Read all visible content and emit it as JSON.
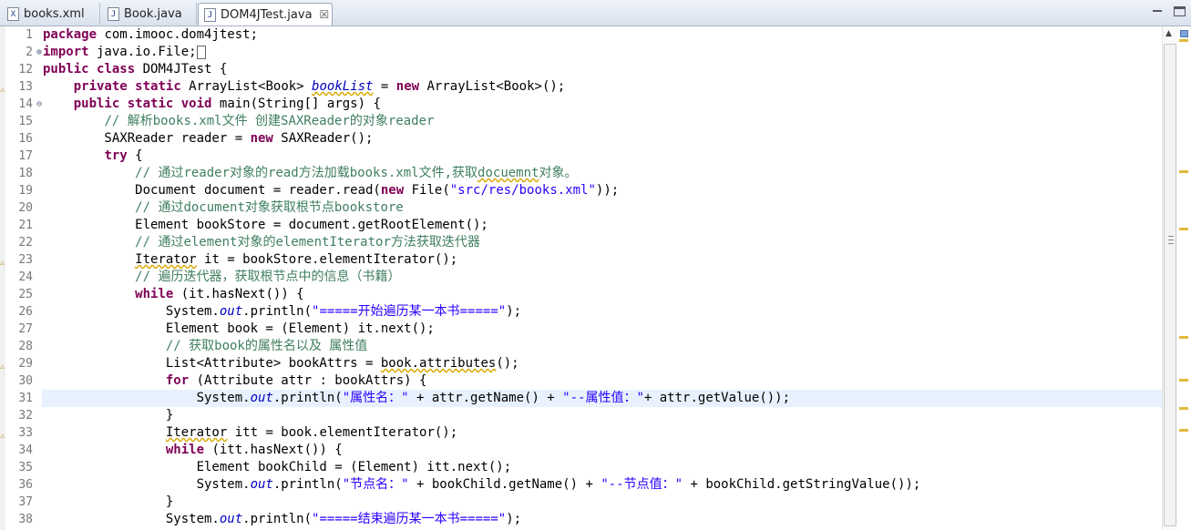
{
  "tabs": [
    {
      "label": "books.xml",
      "icon": "xml-file-icon",
      "glyph": "X",
      "active": false
    },
    {
      "label": "Book.java",
      "icon": "java-file-icon",
      "glyph": "J",
      "active": false
    },
    {
      "label": "DOM4JTest.java",
      "icon": "java-file-icon",
      "glyph": "J",
      "active": true,
      "close": "☒"
    }
  ],
  "editor": {
    "current_line": 31,
    "lines": [
      {
        "no": "1",
        "html": "<span class=\"kw\">package</span> com.imooc.dom4jtest;"
      },
      {
        "no": "2",
        "fold": "⊕",
        "html": "<span class=\"kw\">import</span> java.io.File;<span style=\"display:inline-block;width:8px;height:13px;border:1px solid #666;vertical-align:middle;\"></span>"
      },
      {
        "no": "12",
        "html": "<span class=\"kw\">public</span> <span class=\"kw\">class</span> DOM4JTest {"
      },
      {
        "no": "13",
        "marker": true,
        "html": "    <span class=\"kw\">private</span> <span class=\"kw\">static</span> ArrayList&lt;Book&gt; <span class=\"fld warn\">bookList</span> = <span class=\"kw\">new</span> ArrayList&lt;Book&gt;();"
      },
      {
        "no": "14",
        "fold": "⊖",
        "html": "    <span class=\"kw\">public</span> <span class=\"kw\">static</span> <span class=\"kw\">void</span> main(String[] args) {"
      },
      {
        "no": "15",
        "html": "        <span class=\"cm\">// 解析books.xml文件 创建SAXReader的对象reader</span>"
      },
      {
        "no": "16",
        "html": "        SAXReader reader = <span class=\"kw\">new</span> SAXReader();"
      },
      {
        "no": "17",
        "html": "        <span class=\"kw\">try</span> {"
      },
      {
        "no": "18",
        "html": "            <span class=\"cm\">// 通过reader对象的read方法加载books.xml文件,获取<span class=\"warn\">docuemnt</span>对象。</span>"
      },
      {
        "no": "19",
        "html": "            Document document = reader.read(<span class=\"kw\">new</span> File(<span class=\"str\">\"src/res/books.xml\"</span>));"
      },
      {
        "no": "20",
        "html": "            <span class=\"cm\">// 通过document对象获取根节点bookstore</span>"
      },
      {
        "no": "21",
        "html": "            Element bookStore = document.getRootElement();"
      },
      {
        "no": "22",
        "html": "            <span class=\"cm\">// 通过element对象的elementIterator方法获取迭代器</span>"
      },
      {
        "no": "23",
        "marker": true,
        "html": "            <span class=\"warn\">Iterator</span> it = bookStore.elementIterator();"
      },
      {
        "no": "24",
        "html": "            <span class=\"cm\">// 遍历迭代器，获取根节点中的信息（书籍）</span>"
      },
      {
        "no": "25",
        "html": "            <span class=\"kw\">while</span> (it.hasNext()) {"
      },
      {
        "no": "26",
        "html": "                System.<span class=\"fld\">out</span>.println(<span class=\"str\">\"=====开始遍历某一本书=====\"</span>);"
      },
      {
        "no": "27",
        "html": "                Element book = (Element) it.next();"
      },
      {
        "no": "28",
        "html": "                <span class=\"cm\">// 获取book的属性名以及 属性值</span>"
      },
      {
        "no": "29",
        "marker": true,
        "html": "                List&lt;Attribute&gt; bookAttrs = <span class=\"warn\">book.attributes</span>();"
      },
      {
        "no": "30",
        "html": "                <span class=\"kw\">for</span> (Attribute attr : bookAttrs) {"
      },
      {
        "no": "31",
        "html": "                    System.<span class=\"fld\">out</span>.println(<span class=\"str\">\"属性名：\"</span> + attr.getName() + <span class=\"str\">\"--属性值：\"</span>+ attr.getValue());"
      },
      {
        "no": "32",
        "html": "                }"
      },
      {
        "no": "33",
        "marker": true,
        "html": "                <span class=\"warn\">Iterator</span> itt = book.elementIterator();"
      },
      {
        "no": "34",
        "html": "                <span class=\"kw\">while</span> (itt.hasNext()) {"
      },
      {
        "no": "35",
        "html": "                    Element bookChild = (Element) itt.next();"
      },
      {
        "no": "36",
        "html": "                    System.<span class=\"fld\">out</span>.println(<span class=\"str\">\"节点名：\"</span> + bookChild.getName() + <span class=\"str\">\"--节点值：\"</span> + bookChild.getStringValue());"
      },
      {
        "no": "37",
        "html": "                }"
      },
      {
        "no": "38",
        "html": "                System.<span class=\"fld\">out</span>.println(<span class=\"str\">\"=====结束遍历某一本书=====\"</span>);"
      }
    ]
  },
  "overview_marks": [
    0.025,
    0.285,
    0.4,
    0.615,
    0.7,
    0.755,
    0.8
  ],
  "colors": {
    "keyword": "#7f0055",
    "comment": "#3f7f5f",
    "string": "#2a00ff",
    "field": "#0000c0",
    "current_line": "#e8f2fe"
  }
}
